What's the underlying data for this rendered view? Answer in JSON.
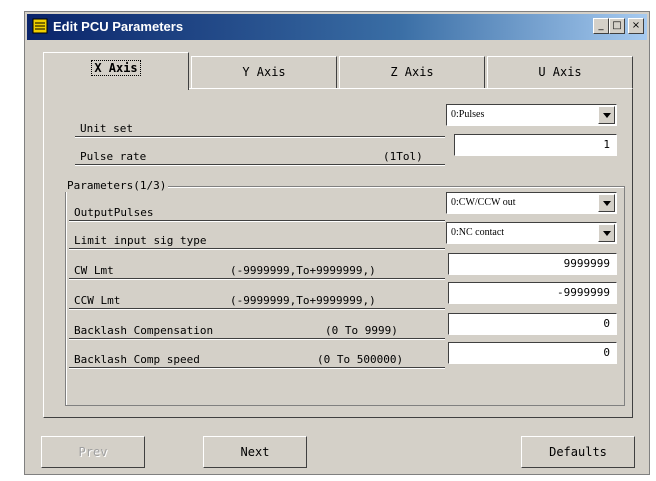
{
  "window": {
    "title": "Edit PCU Parameters",
    "min_glyph": "_",
    "max_glyph": "□",
    "close_glyph": "×"
  },
  "tabs": [
    {
      "label": "X Axis",
      "active": true
    },
    {
      "label": "Y Axis",
      "active": false
    },
    {
      "label": "Z Axis",
      "active": false
    },
    {
      "label": "U Axis",
      "active": false
    }
  ],
  "top_fields": {
    "unit_set": {
      "label": "Unit set",
      "value": "0:Pulses"
    },
    "pulse_rate": {
      "label": "Pulse rate",
      "range": "(1Tol)",
      "value": "1"
    }
  },
  "group": {
    "legend": "Parameters(1/3)"
  },
  "params": {
    "output_pulses": {
      "label": "OutputPulses",
      "value": "0:CW/CCW out"
    },
    "limit_input": {
      "label": "Limit input sig type",
      "value": "0:NC contact"
    },
    "cw_lmt": {
      "label": "CW Lmt",
      "range": "(-9999999,To+9999999,)",
      "value": "9999999"
    },
    "ccw_lmt": {
      "label": "CCW Lmt",
      "range": "(-9999999,To+9999999,)",
      "value": "-9999999"
    },
    "backlash": {
      "label": "Backlash Compensation",
      "range": "(0 To 9999)",
      "value": "0"
    },
    "backlash_speed": {
      "label": "Backlash Comp speed",
      "range": "(0 To 500000)",
      "value": "0"
    }
  },
  "buttons": {
    "prev": "Prev",
    "next": "Next",
    "defaults": "Defaults"
  }
}
